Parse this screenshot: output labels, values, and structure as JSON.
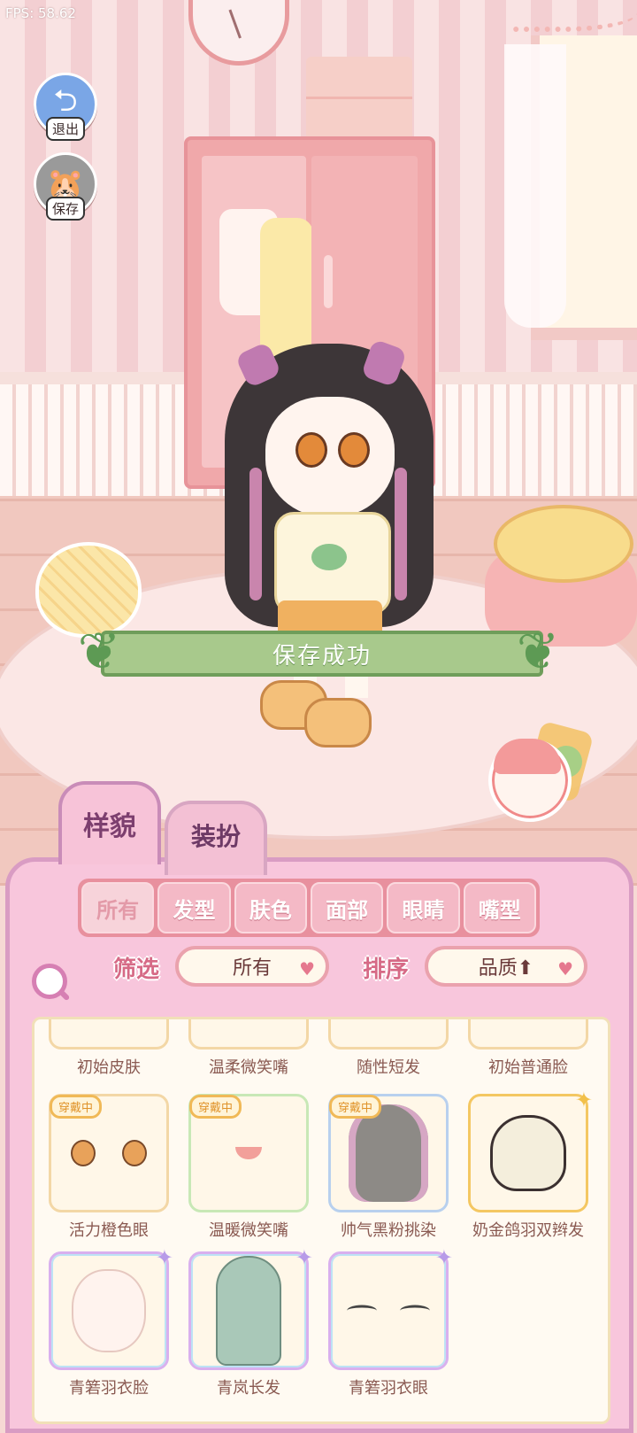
{
  "debug": {
    "fps": "FPS: 58.62"
  },
  "side_buttons": {
    "exit_label": "退出",
    "save_label": "保存"
  },
  "toast": {
    "text": "保存成功"
  },
  "tabs": [
    {
      "label": "样貌",
      "active": true
    },
    {
      "label": "装扮",
      "active": false
    }
  ],
  "categories": [
    {
      "label": "所有",
      "selected": true
    },
    {
      "label": "发型",
      "selected": false
    },
    {
      "label": "肤色",
      "selected": false
    },
    {
      "label": "面部",
      "selected": false
    },
    {
      "label": "眼睛",
      "selected": false
    },
    {
      "label": "嘴型",
      "selected": false
    }
  ],
  "filter": {
    "label": "筛选",
    "value": "所有"
  },
  "sort": {
    "label": "排序",
    "value": "品质⬆"
  },
  "worn_badge": "穿戴中",
  "items": [
    {
      "name": "初始皮肤"
    },
    {
      "name": "温柔微笑嘴"
    },
    {
      "name": "随性短发"
    },
    {
      "name": "初始普通脸"
    },
    {
      "name": "活力橙色眼",
      "worn": true,
      "icon": "orange-eyes-icon"
    },
    {
      "name": "温暖微笑嘴",
      "worn": true,
      "icon": "smile-mouth-icon"
    },
    {
      "name": "帅气黑粉挑染",
      "worn": true,
      "icon": "black-pink-hair-icon"
    },
    {
      "name": "奶金鸽羽双辫发",
      "worn": false,
      "icon": "cream-twin-braids-hair-icon"
    },
    {
      "name": "青箬羽衣脸",
      "worn": false,
      "icon": "face-icon"
    },
    {
      "name": "青岚长发",
      "worn": false,
      "icon": "long-green-hair-icon"
    },
    {
      "name": "青箬羽衣眼",
      "worn": false,
      "icon": "closed-eyes-icon"
    }
  ]
}
